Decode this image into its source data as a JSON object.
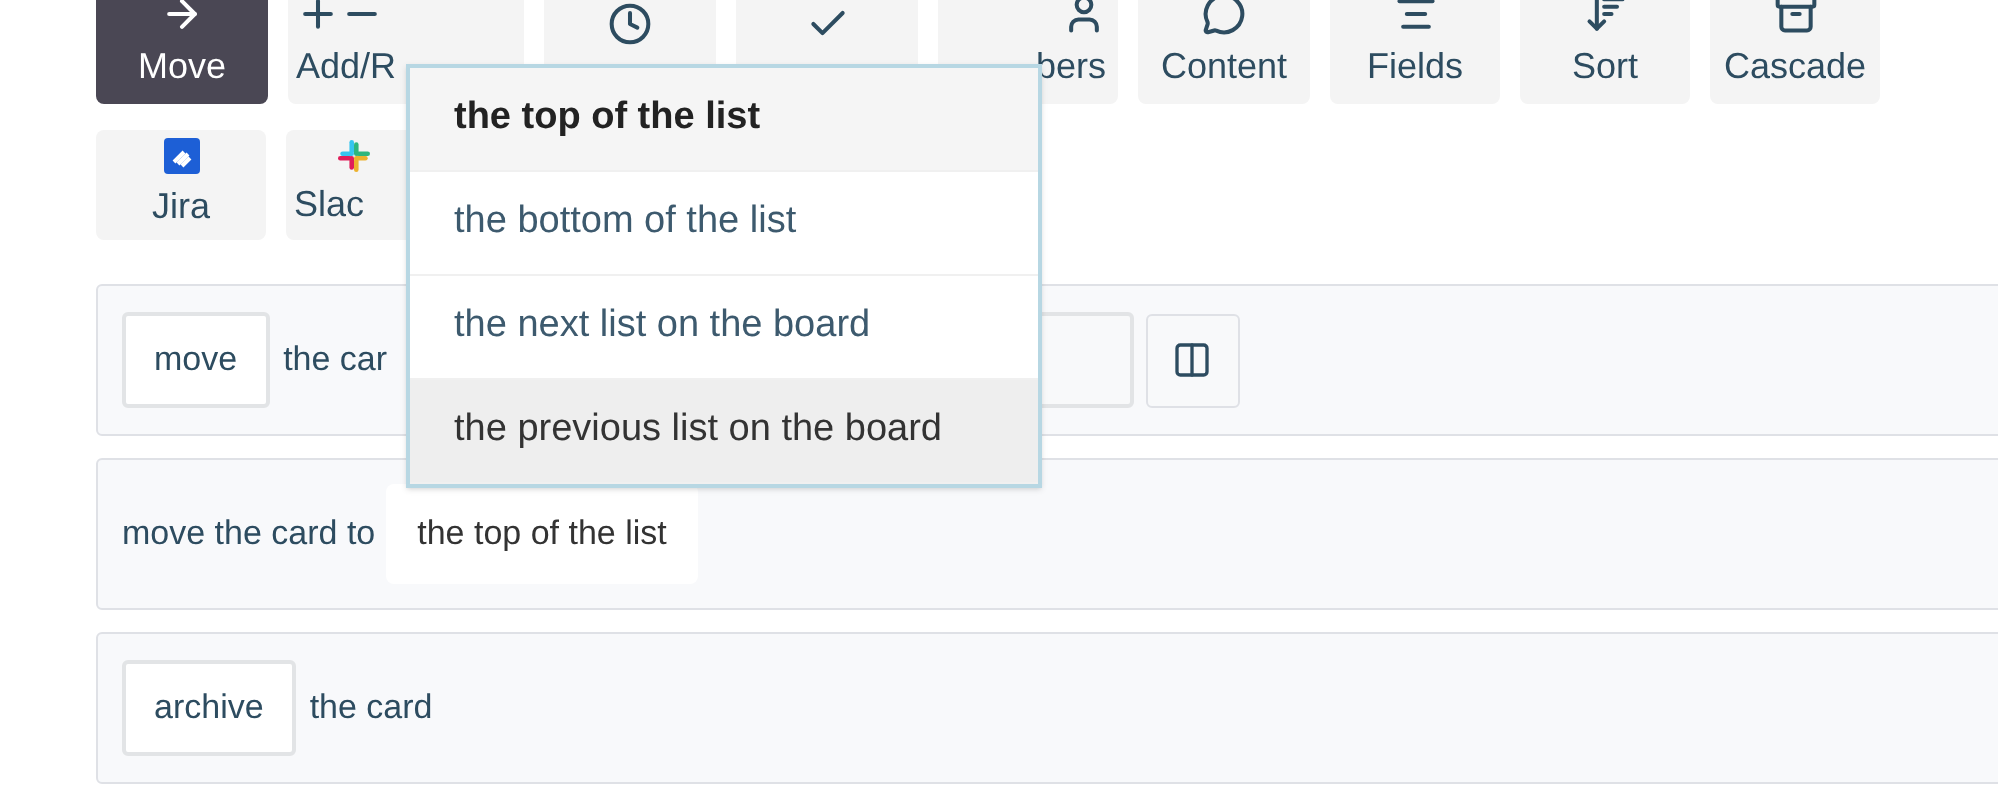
{
  "toolbar": [
    {
      "kind": "move",
      "label": "Move",
      "selected": true
    },
    {
      "kind": "add_remove",
      "label": "Add/R",
      "selected": false
    },
    {
      "kind": "dates",
      "selected": false
    },
    {
      "kind": "checklist",
      "selected": false
    },
    {
      "kind": "members",
      "label": "bers",
      "selected": false
    },
    {
      "kind": "content",
      "label": "Content",
      "selected": false
    },
    {
      "kind": "fields",
      "label": "Fields",
      "selected": false
    },
    {
      "kind": "sort",
      "label": "Sort",
      "selected": false
    },
    {
      "kind": "cascade",
      "label": "Cascade",
      "selected": false
    }
  ],
  "integrations": [
    {
      "kind": "jira",
      "label": "Jira"
    },
    {
      "kind": "slack",
      "label": "Slac"
    }
  ],
  "rules": [
    {
      "kind": "move",
      "select": "move",
      "text": "the car"
    },
    {
      "kind": "move_to",
      "text": "move the card to",
      "value": "the top of the list"
    },
    {
      "kind": "archive",
      "select": "archive",
      "text": "the card"
    }
  ],
  "dropdown": [
    {
      "label": "the top of the list",
      "selected": true,
      "hovered": false
    },
    {
      "label": "the bottom of the list",
      "selected": false,
      "hovered": false
    },
    {
      "label": "the next list on the board",
      "selected": false,
      "hovered": false
    },
    {
      "label": "the previous list on the board",
      "selected": false,
      "hovered": true
    }
  ]
}
